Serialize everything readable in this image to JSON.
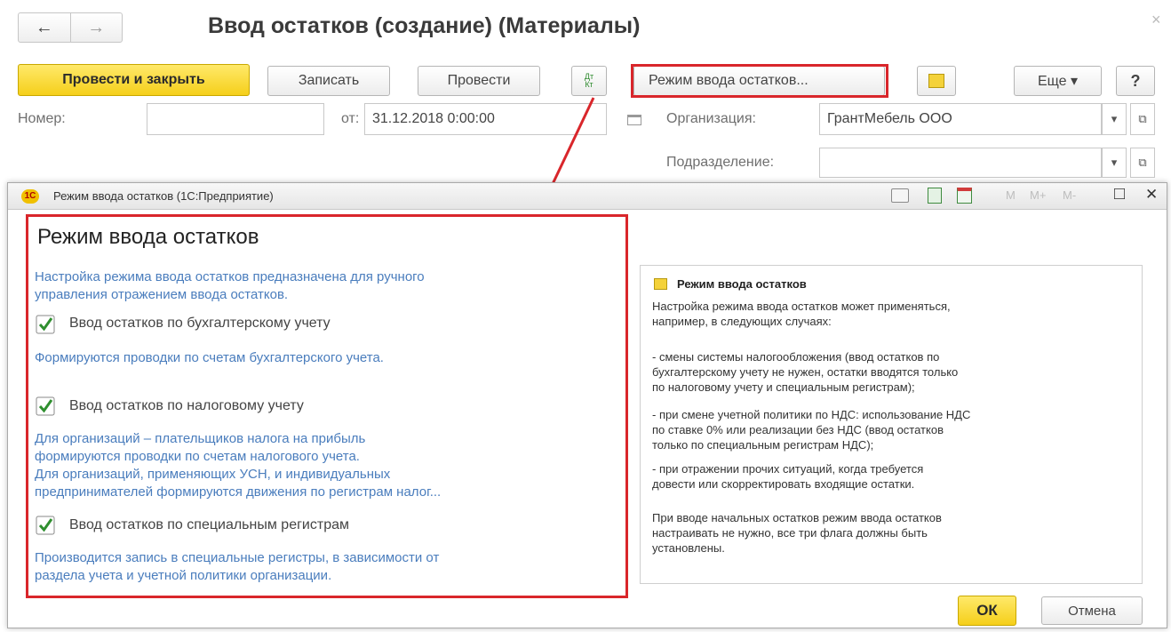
{
  "window": {
    "title": "Ввод остатков (создание) (Материалы)",
    "close_glyph": "×"
  },
  "nav": {
    "back": "←",
    "forward": "→"
  },
  "toolbar": {
    "post_close_label": "Провести и закрыть",
    "save_label": "Записать",
    "post_label": "Провести",
    "dtkt_top": "Дт",
    "dtkt_bottom": "Кт",
    "balance_mode_label": "Режим ввода остатков...",
    "more_label": "Еще ▾",
    "help_label": "?"
  },
  "form": {
    "number_label": "Номер:",
    "number_value": "",
    "date_label": "от:",
    "date_value": "31.12.2018  0:00:00",
    "org_label": "Организация:",
    "org_value": "ГрантМебель ООО",
    "subdiv_label": "Подразделение:",
    "subdiv_value": ""
  },
  "dialog": {
    "title": "Режим ввода остатков  (1С:Предприятие)",
    "logo_text": "1С",
    "tools": {
      "m": "M",
      "mplus": "M+",
      "mminus": "M-",
      "restore": "□",
      "close": "✕"
    },
    "heading": "Режим ввода остатков",
    "intro": [
      "Настройка режима ввода остатков предназначена для ручного",
      "управления отражением  ввода остатков."
    ],
    "options": [
      {
        "label": "Ввод остатков по бухгалтерскому учету",
        "checked": true,
        "desc": [
          "Формируются проводки по счетам бухгалтерского учета."
        ]
      },
      {
        "label": "Ввод остатков по налоговому учету",
        "checked": true,
        "desc": [
          "Для организаций – плательщиков налога на прибыль",
          "формируются проводки по счетам налогового учета.",
          "Для организаций, применяющих УСН, и  индивидуальных",
          "предпринимателей формируются движения по регистрам налог..."
        ]
      },
      {
        "label": "Ввод остатков по специальным регистрам",
        "checked": true,
        "desc": [
          "Производится запись в специальные регистры, в зависимости от",
          "раздела учета и учетной политики организации."
        ]
      }
    ],
    "help": {
      "title": "Режим ввода остатков",
      "p1": [
        "Настройка режима ввода остатков может применяться,",
        "например, в следующих случаях:"
      ],
      "p2": [
        "- смены системы налогообложения (ввод остатков по",
        "бухгалтерскому учету не нужен, остатки вводятся только",
        "по налоговому учету и специальным регистрам);"
      ],
      "p3": [
        "- при смене учетной политики по НДС: использование НДС",
        "по ставке 0% или реализации без НДС (ввод остатков",
        "только по специальным регистрам НДС);"
      ],
      "p4": [
        "- при отражении прочих ситуаций, когда требуется",
        "довести или скорректировать входящие остатки."
      ],
      "p5": [
        "При вводе начальных остатков режим ввода остатков",
        "настраивать не нужно, все три флага должны быть",
        "установлены."
      ]
    },
    "ok_label": "ОК",
    "cancel_label": "Отмена"
  },
  "colors": {
    "accent_yellow": "#f5cf1a",
    "highlight_red": "#d9262b",
    "link_blue": "#4a7dbd"
  }
}
